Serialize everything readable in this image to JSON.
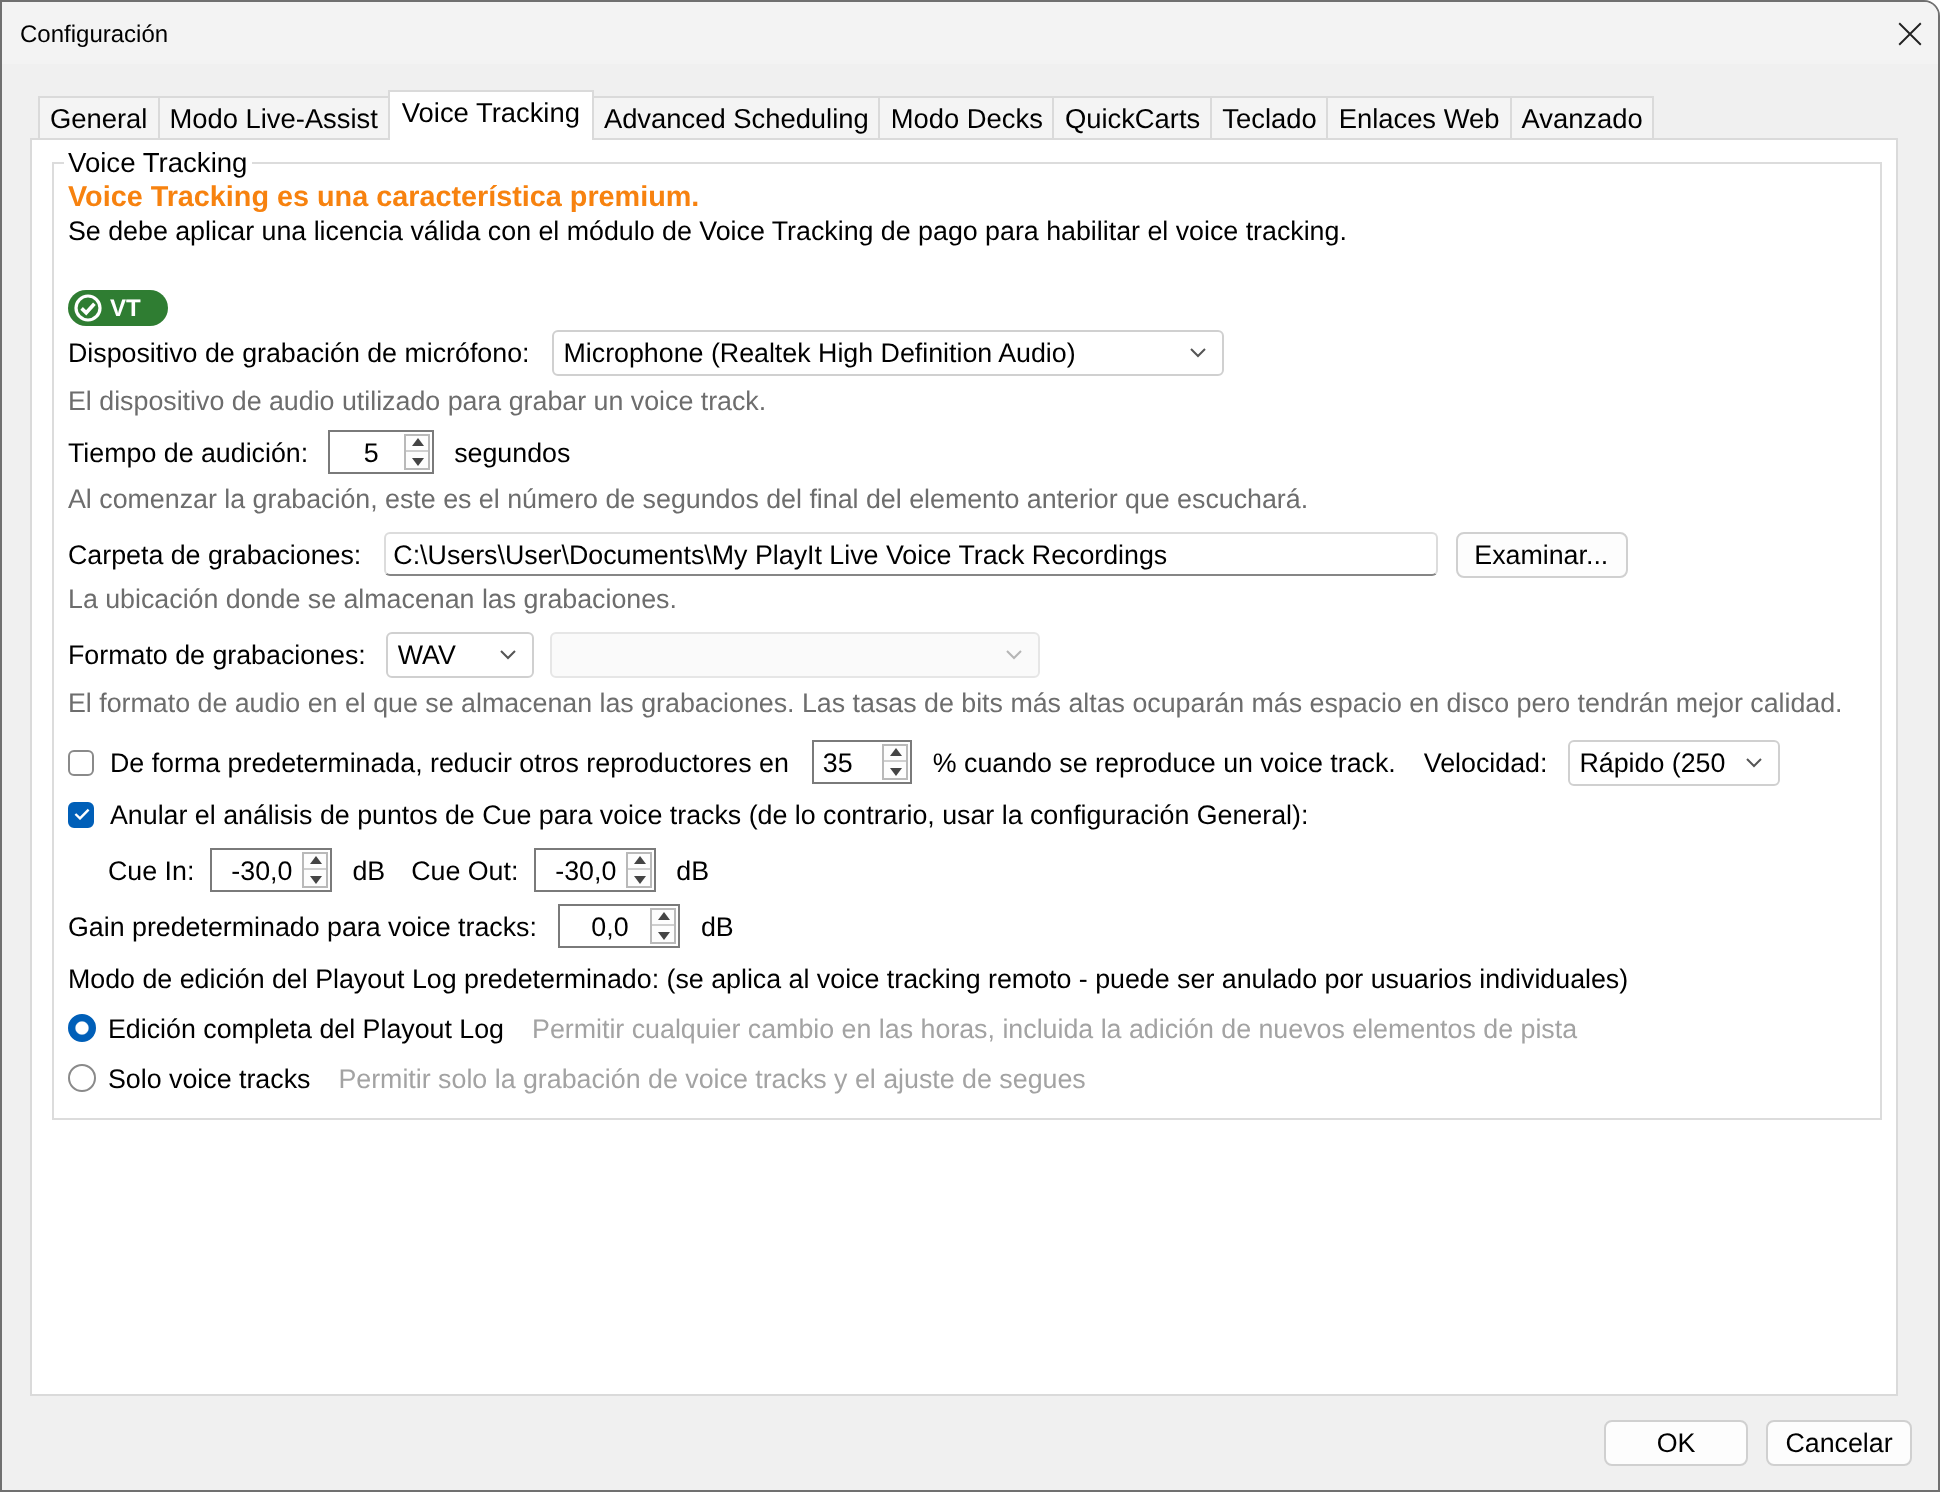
{
  "window": {
    "title": "Configuración"
  },
  "tabs": [
    {
      "label": "General",
      "selected": false
    },
    {
      "label": "Modo Live-Assist",
      "selected": false
    },
    {
      "label": "Voice Tracking",
      "selected": true
    },
    {
      "label": "Advanced Scheduling",
      "selected": false
    },
    {
      "label": "Modo Decks",
      "selected": false
    },
    {
      "label": "QuickCarts",
      "selected": false
    },
    {
      "label": "Teclado",
      "selected": false
    },
    {
      "label": "Enlaces Web",
      "selected": false
    },
    {
      "label": "Avanzado",
      "selected": false
    }
  ],
  "group": {
    "title": "Voice Tracking"
  },
  "notice": {
    "heading": "Voice Tracking es una característica premium.",
    "text": "Se debe aplicar una licencia válida con el módulo de Voice Tracking de pago para habilitar el voice tracking."
  },
  "badge": {
    "label": "VT"
  },
  "microphone": {
    "label": "Dispositivo de grabación de micrófono:",
    "value": "Microphone (Realtek High Definition Audio)",
    "hint": "El dispositivo de audio utilizado para grabar un voice track."
  },
  "preview": {
    "label": "Tiempo de audición:",
    "value": "5",
    "unit": "segundos",
    "hint": "Al comenzar la grabación, este es el número de segundos del final del elemento anterior que escuchará."
  },
  "folder": {
    "label": "Carpeta de grabaciones:",
    "value": "C:\\Users\\User\\Documents\\My PlayIt Live Voice Track Recordings",
    "button": "Examinar...",
    "hint": "La ubicación donde se almacenan las grabaciones."
  },
  "format": {
    "label": "Formato de grabaciones:",
    "value": "WAV",
    "hint": "El formato de audio en el que se almacenan las grabaciones. Las tasas de bits más altas ocuparán más espacio en disco pero tendrán mejor calidad."
  },
  "second_dropdown": {
    "disabled": true
  },
  "duck": {
    "checked": false,
    "label": "De forma predeterminada, reducir otros reproductores en",
    "value": "35",
    "suffix": "% cuando se reproduce un voice track."
  },
  "speed": {
    "label": "Velocidad:",
    "value": "Rápido (250"
  },
  "cue_override": {
    "checked": true,
    "label": "Anular el análisis de puntos de Cue para voice tracks (de lo contrario, usar la configuración General):"
  },
  "cue_in": {
    "label": "Cue In:",
    "value": "-30,0",
    "unit": "dB"
  },
  "cue_out": {
    "label": "Cue Out:",
    "value": "-30,0",
    "unit": "dB"
  },
  "gain": {
    "label": "Gain predeterminado para voice tracks:",
    "value": "0,0",
    "unit": "dB"
  },
  "edit_mode": {
    "label": "Modo de edición del Playout Log predeterminado: (se aplica al voice tracking remoto - puede ser anulado por usuarios individuales)",
    "options": [
      {
        "label": "Edición completa del Playout Log",
        "description": "Permitir cualquier cambio en las horas, incluida la adición de nuevos elementos de pista",
        "selected": true
      },
      {
        "label": "Solo voice tracks",
        "description": "Permitir solo la grabación de voice tracks y el ajuste de segues",
        "selected": false
      }
    ]
  },
  "buttons": [
    "OK",
    "Cancelar"
  ]
}
